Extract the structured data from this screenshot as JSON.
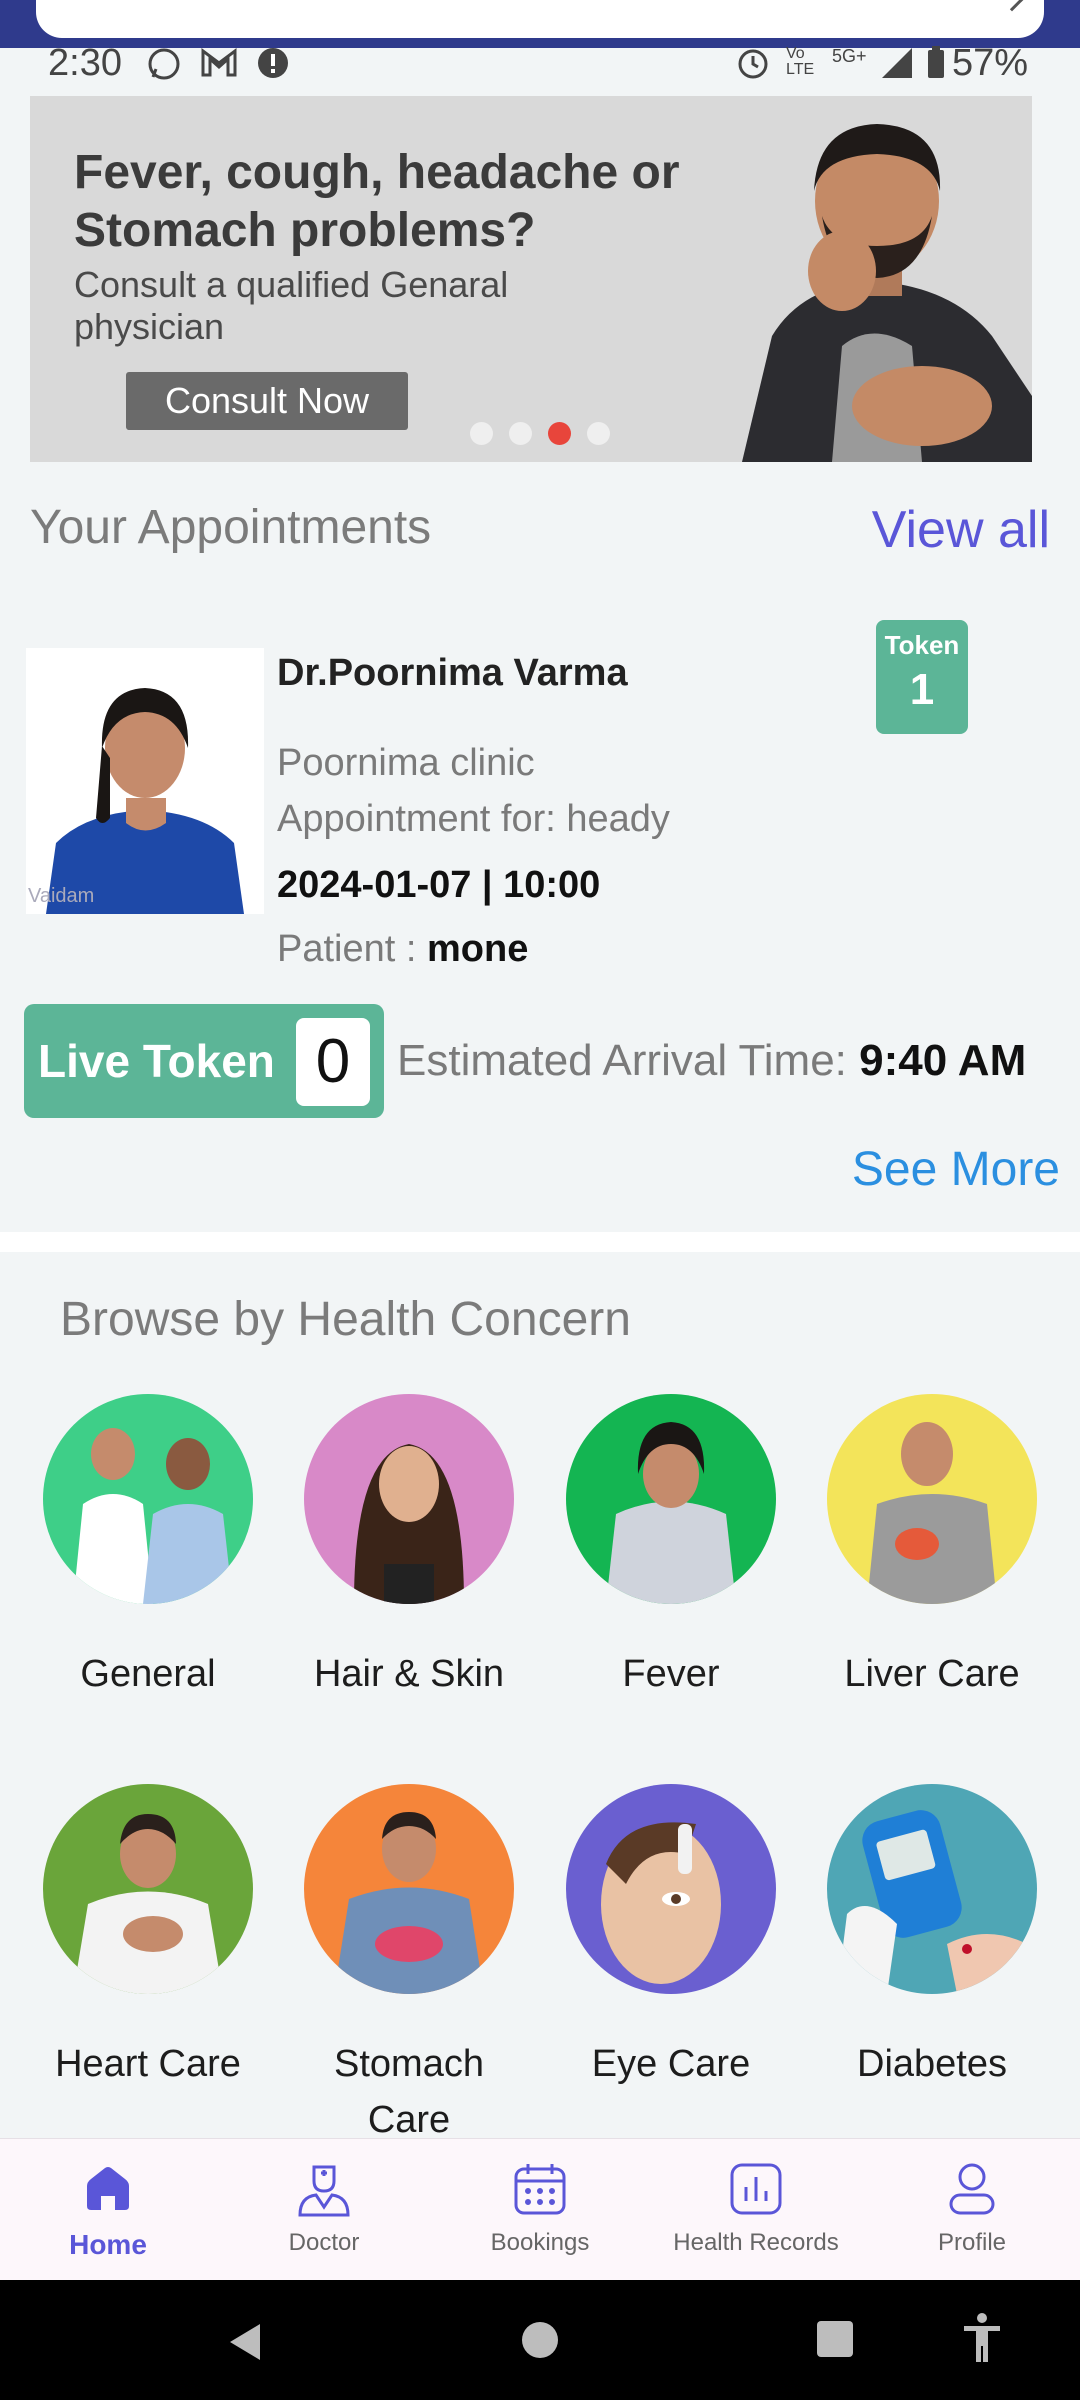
{
  "status_bar": {
    "time": "2:30",
    "battery": "57%",
    "network": "5G+"
  },
  "banner": {
    "headline": "Fever, cough, headache or Stomach problems?",
    "subtext": "Consult a qualified Genaral physician",
    "cta_label": "Consult Now",
    "slide_count": 4,
    "active_slide": 3
  },
  "appointments": {
    "title": "Your Appointments",
    "view_all": "View all",
    "card": {
      "doctor_name": "Dr.Poornima Varma",
      "clinic": "Poornima clinic",
      "appointment_for": "Appointment for: heady",
      "datetime": "2024-01-07 | 10:00",
      "patient_label": "Patient : ",
      "patient_name": "mone",
      "token_label": "Token",
      "token_number": "1",
      "photo_watermark": "Vaidam"
    },
    "live_token_label": "Live Token",
    "live_token_value": "0",
    "eta_label": "Estimated Arrival Time: ",
    "eta_value": "9:40 AM",
    "see_more": "See More"
  },
  "browse": {
    "title": "Browse by Health Concern",
    "categories": [
      {
        "label": "General",
        "color": "#3ecf88"
      },
      {
        "label": "Hair & Skin",
        "color": "#d889c8"
      },
      {
        "label": "Fever",
        "color": "#14b552"
      },
      {
        "label": "Liver Care",
        "color": "#f3e45a"
      },
      {
        "label": "Heart Care",
        "color": "#6aa53a"
      },
      {
        "label": "Stomach Care",
        "color": "#f5853a"
      },
      {
        "label": "Eye Care",
        "color": "#6a5fd0"
      },
      {
        "label": "Diabetes",
        "color": "#4fa6b5"
      }
    ]
  },
  "bottom_nav": {
    "items": [
      {
        "label": "Home",
        "icon": "home-icon"
      },
      {
        "label": "Doctor",
        "icon": "doctor-icon"
      },
      {
        "label": "Bookings",
        "icon": "calendar-icon"
      },
      {
        "label": "Health Records",
        "icon": "chart-icon"
      },
      {
        "label": "Profile",
        "icon": "profile-icon"
      }
    ],
    "active": "Home"
  }
}
